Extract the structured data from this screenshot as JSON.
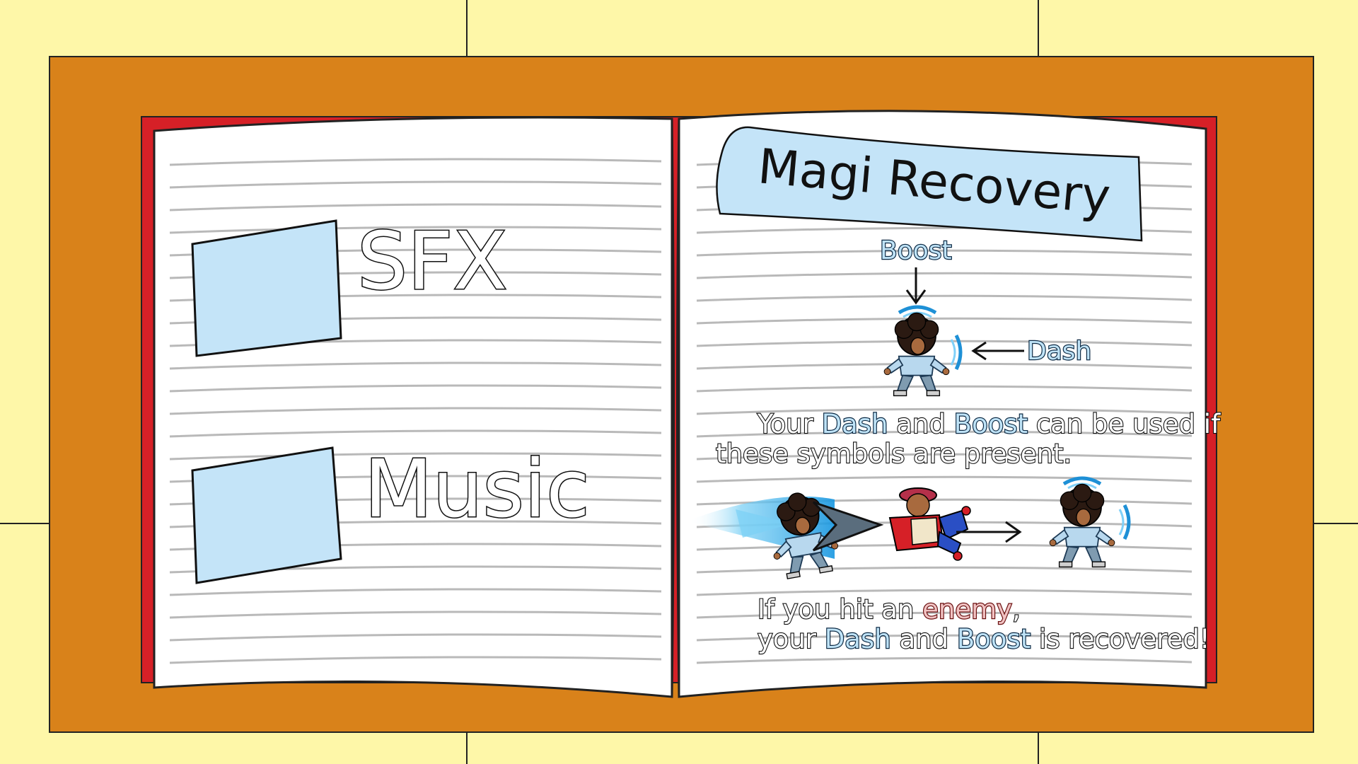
{
  "left_page": {
    "options": [
      {
        "label": "SFX",
        "checked": false
      },
      {
        "label": "Music",
        "checked": false
      }
    ]
  },
  "right_page": {
    "title": "Magi Recovery",
    "diagram": {
      "boost_label": "Boost",
      "dash_label": "Dash"
    },
    "line1": {
      "a": "Your ",
      "b": "Dash",
      "c": " and ",
      "d": "Boost",
      "e": " can be used if"
    },
    "line2": "these symbols are present.",
    "line3": {
      "a": "If you hit an ",
      "b": "enemy",
      "c": ","
    },
    "line4": {
      "a": "your ",
      "b": "Dash",
      "c": " and ",
      "d": "Boost",
      "e": " is recovered!"
    }
  },
  "colors": {
    "background": "#fef7a8",
    "desk": "#d9821a",
    "book_cover": "#d62027",
    "page": "#ffffff",
    "checkbox": "#c4e4f8",
    "banner": "#c4e4f8",
    "keyword_blue": "#0d2a44",
    "keyword_red": "#6a1010"
  },
  "icons": [
    "checkbox-sfx",
    "checkbox-music",
    "hero-character-icon",
    "enemy-character-icon",
    "boost-symbol-icon",
    "dash-symbol-icon",
    "arrow-icon"
  ]
}
